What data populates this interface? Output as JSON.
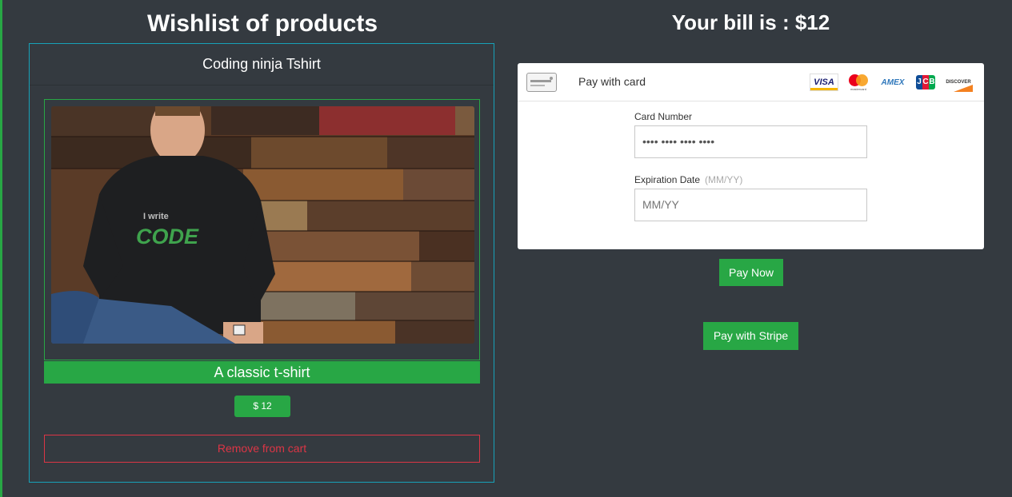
{
  "wishlist": {
    "title": "Wishlist of products",
    "product": {
      "name": "Coding ninja Tshirt",
      "image_alt": "Man wearing black t-shirt printed I write CODE",
      "shirt_text_small": "I write",
      "shirt_text_big": "CODE",
      "description": "A classic t-shirt",
      "price": "$ 12",
      "remove_label": "Remove from cart"
    }
  },
  "payment": {
    "bill_title": "Your bill is : $12",
    "card_widget": {
      "header_label": "Pay with card",
      "brands": [
        "visa",
        "mastercard",
        "amex",
        "jcb",
        "discover"
      ],
      "brand_text": {
        "visa": "VISA",
        "amex": "AMEX",
        "jcb": [
          "J",
          "C",
          "B"
        ],
        "discover": "DISCOVER",
        "mastercard": "mastercard"
      },
      "card_number_label": "Card Number",
      "card_number_placeholder": "•••• •••• •••• ••••",
      "expiry_label": "Expiration Date",
      "expiry_hint": "(MM/YY)",
      "expiry_placeholder": "MM/YY"
    },
    "pay_now_label": "Pay Now",
    "pay_stripe_label": "Pay with Stripe"
  },
  "colors": {
    "background": "#343a40",
    "success": "#28a745",
    "danger": "#dc3545",
    "info_border": "#17a2b8"
  }
}
